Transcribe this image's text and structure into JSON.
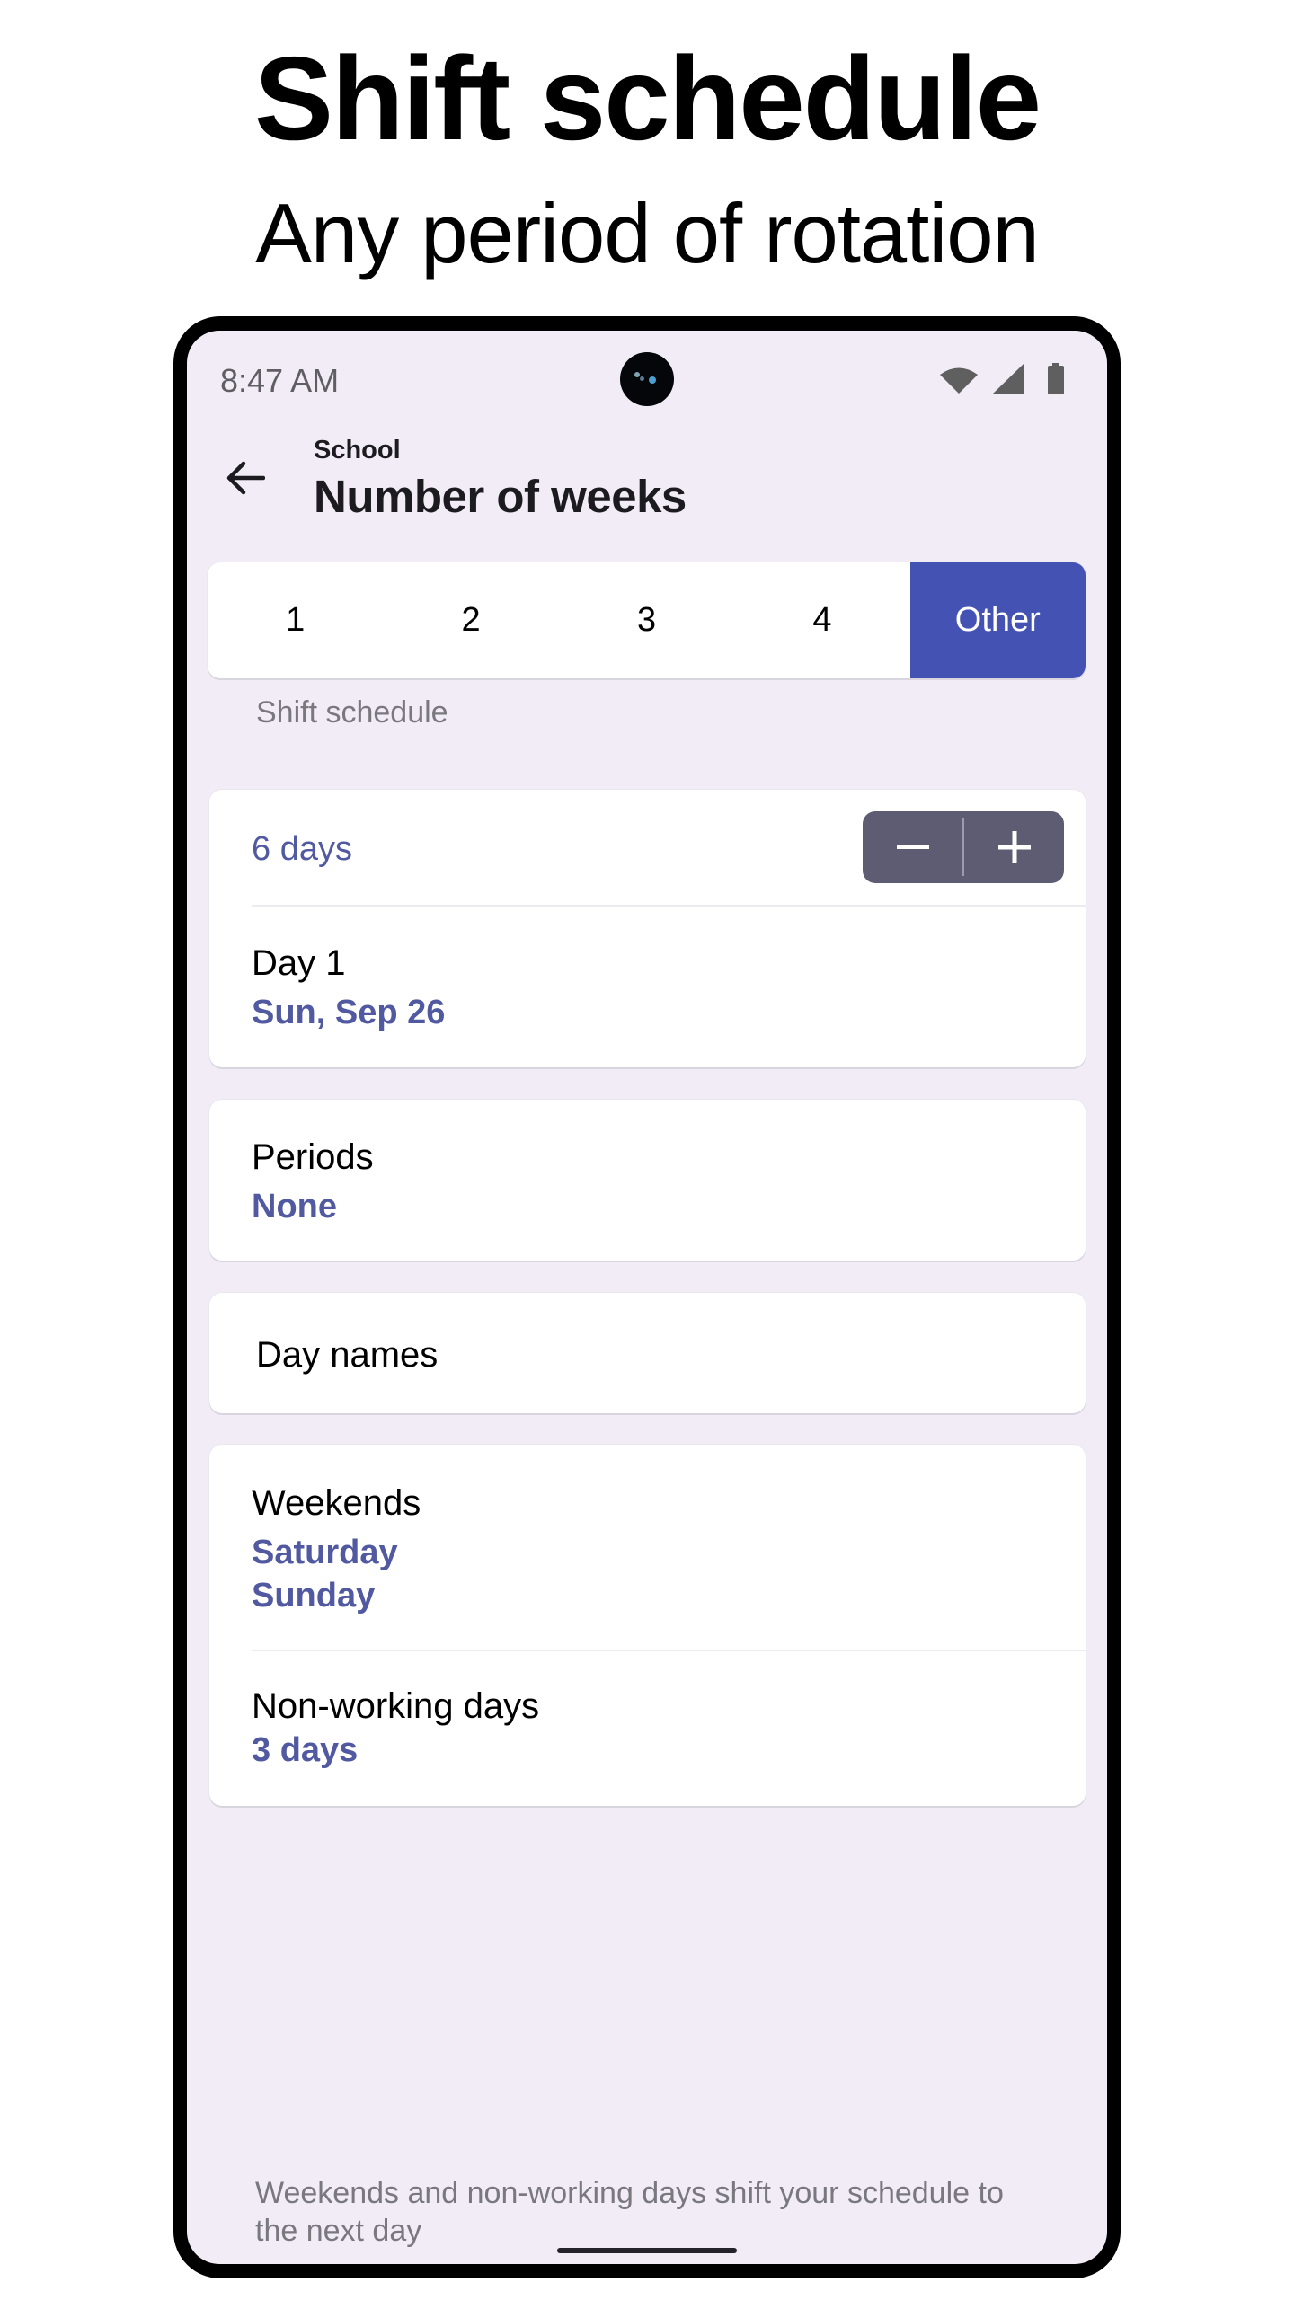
{
  "promo": {
    "title": "Shift schedule",
    "subtitle": "Any period of rotation"
  },
  "status_bar": {
    "time": "8:47 AM",
    "icons": [
      "wifi-icon",
      "signal-icon",
      "battery-icon"
    ]
  },
  "header": {
    "back_icon": "arrow-back-icon",
    "subtitle": "School",
    "title": "Number of weeks"
  },
  "weeks_selector": {
    "options": [
      "1",
      "2",
      "3",
      "4",
      "Other"
    ],
    "selected": "Other",
    "caption": "Shift schedule"
  },
  "rotation_card": {
    "length_value": "6 days",
    "stepper": {
      "decrement_icon": "minus-icon",
      "increment_icon": "plus-icon"
    },
    "day1_label": "Day 1",
    "day1_value": "Sun, Sep 26"
  },
  "periods_card": {
    "label": "Periods",
    "value": "None"
  },
  "day_names_card": {
    "label": "Day names"
  },
  "weekends_card": {
    "weekends_label": "Weekends",
    "weekends_values": [
      "Saturday",
      "Sunday"
    ],
    "nonworking_label": "Non-working days",
    "nonworking_value": "3 days"
  },
  "footnote": "Weekends and non-working days shift your schedule to the next day",
  "colors": {
    "accent": "#4453b3",
    "value_text": "#5159a0",
    "screen_bg": "#f1ecf6",
    "stepper_bg": "#5d5c72",
    "caption_text": "#7a787f"
  }
}
